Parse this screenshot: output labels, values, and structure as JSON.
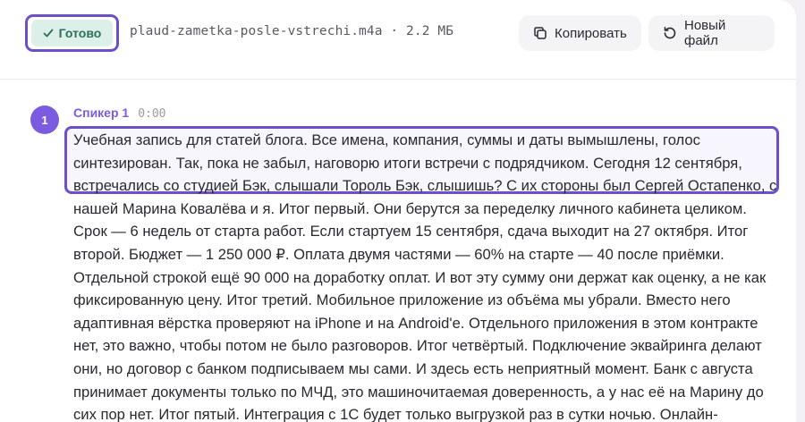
{
  "header": {
    "status_label": "Готово",
    "filename": "plaud-zametka-posle-vstrechi.m4a · 2.2 МБ",
    "copy_label": "Копировать",
    "new_file_label": "Новый файл"
  },
  "colors": {
    "accent": "#7b5ce0",
    "status_bg": "#dcefe9",
    "status_text": "#2d6f5c",
    "highlight_border": "#6b50c8"
  },
  "icons": {
    "status": "check-icon",
    "copy": "copy-icon",
    "new_file": "refresh-icon"
  },
  "segment": {
    "speaker_number": "1",
    "speaker_name": "Спикер 1",
    "timestamp": "0:00",
    "lines": [
      "Учебная запись для статей блога. Все имена, компания, суммы и даты вымышлены, голос",
      "синтезирован. Так, пока не забыл, наговорю итоги встречи с подрядчиком. Сегодня 12 сентября,",
      "встречались со студией Бэк, слышали Тороль Бэк, слышишь? С их стороны был Сергей Остапенко, с",
      "нашей Марина Ковалёва и я. Итог первый. Они берутся за переделку личного кабинета целиком.",
      "Срок — 6 недель от старта работ. Если стартуем 15 сентября, сдача выходит на 27 октября. Итог",
      "второй. Бюджет — 1 250 000 ₽. Оплата двумя частями — 60% на старте — 40 после приёмки.",
      "Отдельной строкой ещё 90 000 на доработку оплат. И вот эту сумму они держат как оценку, а не как",
      "фиксированную цену. Итог третий. Мобильное приложение из объёма мы убрали. Вместо него",
      "адаптивная вёрстка проверяют на iPhone и на Android'е. Отдельного приложения в этом контракте",
      "нет, это важно, чтобы потом не было разговоров. Итог четвёртый. Подключение эквайринга делают",
      "они, но договор с банком подписываем мы сами. И здесь есть неприятный момент. Банк с августа",
      "принимает документы только по МЧД, это машиночитаемая доверенность, а у нас её на Марину до",
      "сих пор нет. Итог пятый. Интеграция с 1С будет только выгрузкой раз в сутки ночью. Онлайн-"
    ]
  }
}
